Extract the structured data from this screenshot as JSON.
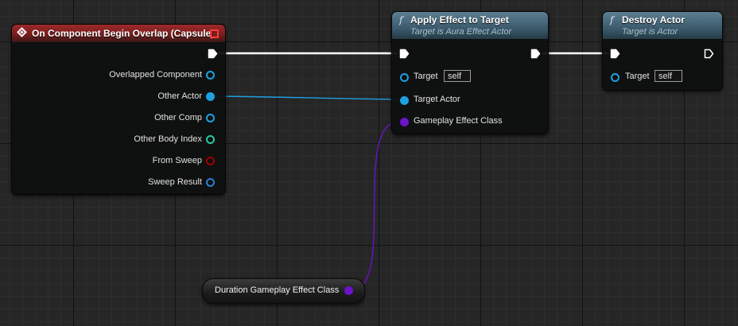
{
  "graph": {
    "colors": {
      "exec": "#ffffff",
      "object": "#1da1e2",
      "struct": "#2a7fd4",
      "int": "#27c9a2",
      "bool": "#a10000",
      "class": "#6c12c9"
    }
  },
  "event_node": {
    "title": "On Component Begin Overlap (Capsule)",
    "icon": "event-diamond-icon",
    "pins": [
      {
        "label": "Overlapped Component",
        "type": "object",
        "connected": false
      },
      {
        "label": "Other Actor",
        "type": "object",
        "connected": true
      },
      {
        "label": "Other Comp",
        "type": "object",
        "connected": false
      },
      {
        "label": "Other Body Index",
        "type": "int",
        "connected": false
      },
      {
        "label": "From Sweep",
        "type": "bool",
        "connected": false
      },
      {
        "label": "Sweep Result",
        "type": "struct",
        "connected": false
      }
    ]
  },
  "apply_node": {
    "title": "Apply Effect to Target",
    "subtitle": "Target is Aura Effect Actor",
    "icon": "function-icon",
    "icon_glyph": "f",
    "pins": [
      {
        "label": "Target",
        "default": "self",
        "type": "object",
        "connected": false
      },
      {
        "label": "Target Actor",
        "type": "object",
        "connected": true
      },
      {
        "label": "Gameplay Effect Class",
        "type": "class",
        "connected": true
      }
    ]
  },
  "destroy_node": {
    "title": "Destroy Actor",
    "subtitle": "Target is Actor",
    "icon": "function-icon",
    "icon_glyph": "f",
    "pins": [
      {
        "label": "Target",
        "default": "self",
        "type": "object",
        "connected": false
      }
    ]
  },
  "variable_node": {
    "label": "Duration Gameplay Effect Class",
    "type": "class"
  }
}
